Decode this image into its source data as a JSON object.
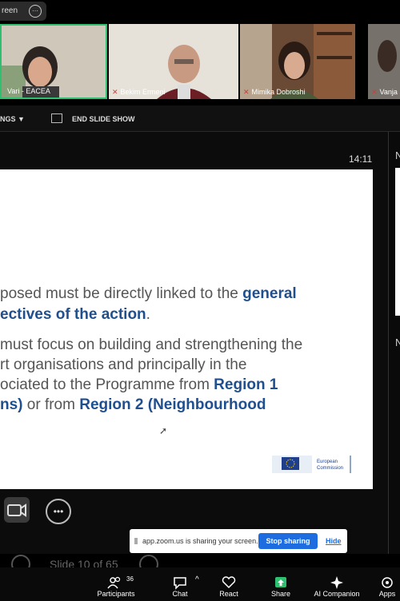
{
  "share_pill": {
    "label": "reen",
    "more_icon": "⋯"
  },
  "participants_video": [
    {
      "name": "Vari - EACEA"
    },
    {
      "name": "Bekim Ermeni"
    },
    {
      "name": "Mimika Dobroshi"
    },
    {
      "name": "Vanja"
    }
  ],
  "toolbar": {
    "settings_label": "NGS ▼",
    "end_show_label": "END SLIDE SHOW"
  },
  "time": "14:11",
  "slide": {
    "l1a": "posed must be directly linked to the ",
    "l1b": "general",
    "l2a": "ectives of the action",
    "l2b": ".",
    "l3": "must focus on building and strengthening the",
    "l4": "rt organisations and principally in the",
    "l5a": "ociated to the Programme from ",
    "l5b": "Region 1",
    "l6a": "ns)",
    "l6b": " or from ",
    "l6c": "Region 2 (Neighbourhood",
    "logo_text1": "European",
    "logo_text2": "Commission"
  },
  "right_panel": {
    "letter1": "N",
    "letter2": "N"
  },
  "share_bar": {
    "text": "app.zoom.us is sharing your screen.",
    "stop": "Stop sharing",
    "hide": "Hide"
  },
  "slide_nav": "Slide 10 of 65",
  "bottom_bar": {
    "participants_label": "Participants",
    "participants_count": "36",
    "chat_label": "Chat",
    "react_label": "React",
    "share_label": "Share",
    "ai_label": "AI Companion",
    "apps_label": "Apps"
  },
  "colors": {
    "accent_blue": "#1d6ce0",
    "slide_blue": "#1f4f8f",
    "active_speaker": "#2fbf71"
  }
}
